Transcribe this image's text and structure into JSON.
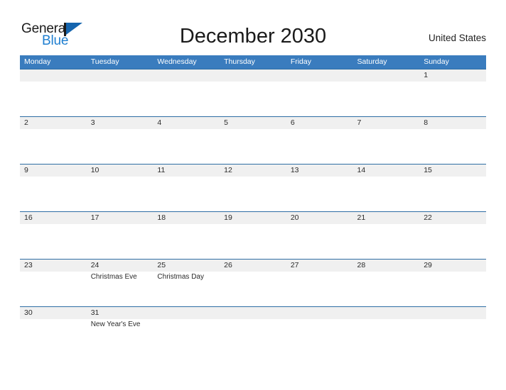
{
  "logo": {
    "text_primary": "General",
    "text_secondary": "Blue",
    "flag_icon": "blue-flag-triangle-icon",
    "color_primary": "#1b1b1b",
    "color_secondary": "#1f7fd0",
    "flag_color": "#1565ae"
  },
  "header": {
    "title": "December 2030",
    "region": "United States"
  },
  "theme": {
    "header_bar_color": "#3a7cbe",
    "row_divider_color": "#2e6da4",
    "date_band_color": "#f0f0f0",
    "page_background": "#ffffff",
    "text_color": "#2b2b2b"
  },
  "calendar": {
    "month": "December",
    "year": "2030",
    "first_day_of_week": "Monday",
    "weekdays": [
      "Monday",
      "Tuesday",
      "Wednesday",
      "Thursday",
      "Friday",
      "Saturday",
      "Sunday"
    ],
    "weeks": [
      [
        {
          "day": "",
          "event": ""
        },
        {
          "day": "",
          "event": ""
        },
        {
          "day": "",
          "event": ""
        },
        {
          "day": "",
          "event": ""
        },
        {
          "day": "",
          "event": ""
        },
        {
          "day": "",
          "event": ""
        },
        {
          "day": "1",
          "event": ""
        }
      ],
      [
        {
          "day": "2",
          "event": ""
        },
        {
          "day": "3",
          "event": ""
        },
        {
          "day": "4",
          "event": ""
        },
        {
          "day": "5",
          "event": ""
        },
        {
          "day": "6",
          "event": ""
        },
        {
          "day": "7",
          "event": ""
        },
        {
          "day": "8",
          "event": ""
        }
      ],
      [
        {
          "day": "9",
          "event": ""
        },
        {
          "day": "10",
          "event": ""
        },
        {
          "day": "11",
          "event": ""
        },
        {
          "day": "12",
          "event": ""
        },
        {
          "day": "13",
          "event": ""
        },
        {
          "day": "14",
          "event": ""
        },
        {
          "day": "15",
          "event": ""
        }
      ],
      [
        {
          "day": "16",
          "event": ""
        },
        {
          "day": "17",
          "event": ""
        },
        {
          "day": "18",
          "event": ""
        },
        {
          "day": "19",
          "event": ""
        },
        {
          "day": "20",
          "event": ""
        },
        {
          "day": "21",
          "event": ""
        },
        {
          "day": "22",
          "event": ""
        }
      ],
      [
        {
          "day": "23",
          "event": ""
        },
        {
          "day": "24",
          "event": "Christmas Eve"
        },
        {
          "day": "25",
          "event": "Christmas Day"
        },
        {
          "day": "26",
          "event": ""
        },
        {
          "day": "27",
          "event": ""
        },
        {
          "day": "28",
          "event": ""
        },
        {
          "day": "29",
          "event": ""
        }
      ],
      [
        {
          "day": "30",
          "event": ""
        },
        {
          "day": "31",
          "event": "New Year's Eve"
        },
        {
          "day": "",
          "event": ""
        },
        {
          "day": "",
          "event": ""
        },
        {
          "day": "",
          "event": ""
        },
        {
          "day": "",
          "event": ""
        },
        {
          "day": "",
          "event": ""
        }
      ]
    ]
  }
}
